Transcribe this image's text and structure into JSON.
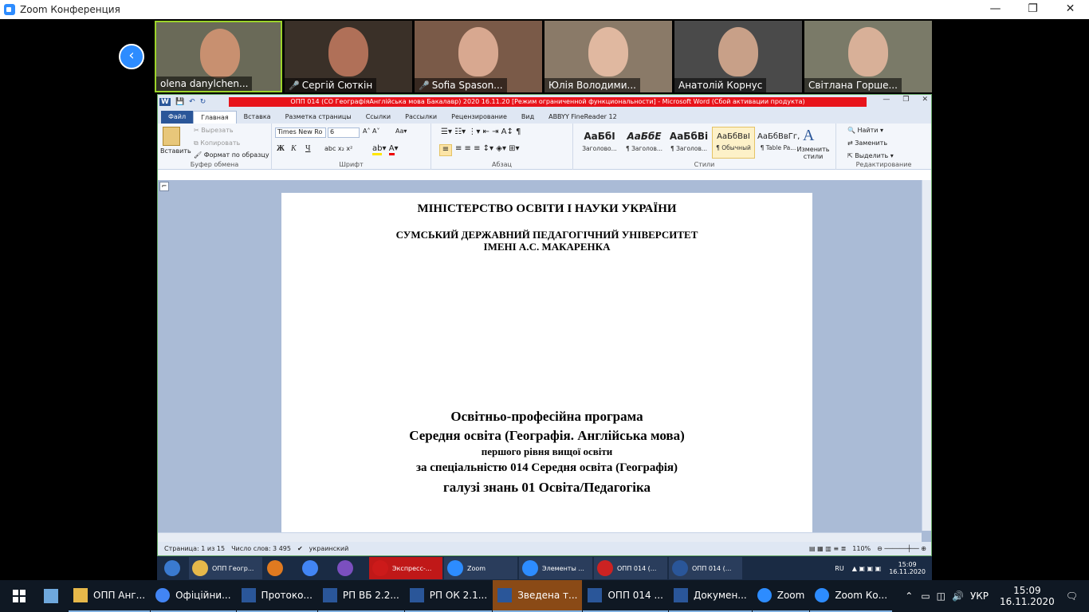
{
  "zoom": {
    "window_title": "Zoom Конференция",
    "participants": [
      {
        "name": "olena danylchen...",
        "muted": false,
        "active": true
      },
      {
        "name": "Сергій Сюткін",
        "muted": true,
        "active": false
      },
      {
        "name": "Sofia Spason...",
        "muted": true,
        "active": false
      },
      {
        "name": "Юлія Володими...",
        "muted": false,
        "active": false
      },
      {
        "name": "Анатолій Корнус",
        "muted": false,
        "active": false
      },
      {
        "name": "Світлана Горше...",
        "muted": false,
        "active": false
      }
    ]
  },
  "word": {
    "title": "ОПП 014 (СО ГеографіяАнглійська мова Бакалавр) 2020 16.11.20 [Режим ограниченной функциональности] - Microsoft Word (Сбой активации продукта)",
    "tabs": [
      "Файл",
      "Главная",
      "Вставка",
      "Разметка страницы",
      "Ссылки",
      "Рассылки",
      "Рецензирование",
      "Вид",
      "ABBYY FineReader 12"
    ],
    "clipboard": {
      "paste": "Вставить",
      "cut": "Вырезать",
      "copy": "Копировать",
      "format": "Формат по образцу",
      "label": "Буфер обмена"
    },
    "font": {
      "name": "Times New Ro",
      "size": "6",
      "label": "Шрифт",
      "bold": "Ж",
      "italic": "К",
      "underline": "Ч"
    },
    "paragraph_label": "Абзац",
    "styles": [
      {
        "preview": "АаБбІ",
        "name": "Заголово..."
      },
      {
        "preview": "АаБбЕ",
        "name": "¶ Заголов..."
      },
      {
        "preview": "АаБбВі",
        "name": "¶ Заголов..."
      },
      {
        "preview": "АаБбВвІ",
        "name": "¶ Обычный"
      },
      {
        "preview": "АаБбВвГг,",
        "name": "¶ Table Pa..."
      }
    ],
    "styles_label": "Стили",
    "change_styles": "Изменить стили",
    "editing": {
      "find": "Найти",
      "replace": "Заменить",
      "select": "Выделить",
      "label": "Редактирование"
    },
    "doc": {
      "line1": "МІНІСТЕРСТВО ОСВІТИ І НАУКИ УКРАЇНИ",
      "line2": "СУМСЬКИЙ ДЕРЖАВНИЙ ПЕДАГОГІЧНИЙ УНІВЕРСИТЕТ",
      "line3": "ІМЕНІ А.С. МАКАРЕНКА",
      "prog1": "Освітньо-професійна програма",
      "prog2": "Середня освіта (Географія. Англійська мова)",
      "prog3": "першого рівня вищої освіти",
      "prog4": "за спеціальністю 014 Середня освіта (Географія)",
      "prog5": "галузі знань 01 Освіта/Педагогіка"
    },
    "status": {
      "page": "Страница: 1 из 15",
      "words": "Число слов: 3 495",
      "lang": "украинский",
      "zoom": "110%"
    }
  },
  "remote_taskbar": [
    {
      "label": "ОПП Геогр...",
      "color": "#e6b84a"
    },
    {
      "label": "",
      "color": "#e07a20"
    },
    {
      "label": "",
      "color": "#4285f4"
    },
    {
      "label": "",
      "color": "#7b4fbf"
    },
    {
      "label": "Экспресс-...",
      "color": "#cc1a1a"
    },
    {
      "label": "Zoom",
      "color": "#2d8cff"
    },
    {
      "label": "Элементы ...",
      "color": "#2d8cff"
    },
    {
      "label": "ОПП 014 (...",
      "color": "#cc2222"
    },
    {
      "label": "ОПП 014 (...",
      "color": "#2a5699"
    }
  ],
  "remote_tray": {
    "lang": "RU",
    "time": "15:09",
    "date": "16.11.2020"
  },
  "taskbar": [
    {
      "label": "",
      "color": "#6fa8dc"
    },
    {
      "label": "ОПП Анг...",
      "color": "#e6b84a"
    },
    {
      "label": "Офіційни...",
      "color": "#4285f4"
    },
    {
      "label": "Протоко...",
      "color": "#2a5699"
    },
    {
      "label": "РП ВБ 2.2...",
      "color": "#2a5699"
    },
    {
      "label": "РП ОК 2.1...",
      "color": "#2a5699"
    },
    {
      "label": "Зведена т...",
      "color": "#2a5699",
      "active": true
    },
    {
      "label": "ОПП 014 ...",
      "color": "#2a5699"
    },
    {
      "label": "Докумен...",
      "color": "#2a5699"
    },
    {
      "label": "Zoom",
      "color": "#2d8cff"
    },
    {
      "label": "Zoom Ко...",
      "color": "#2d8cff"
    }
  ],
  "tray": {
    "lang": "УКР",
    "time": "15:09",
    "date": "16.11.2020"
  }
}
